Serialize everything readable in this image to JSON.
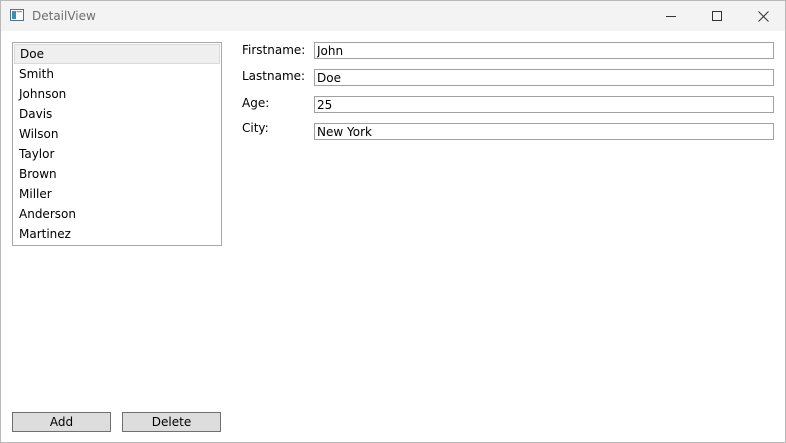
{
  "window": {
    "title": "DetailView",
    "icon": "app-window-icon",
    "controls": [
      "minimize-icon",
      "maximize-icon",
      "close-icon"
    ]
  },
  "list": {
    "items": [
      "Doe",
      "Smith",
      "Johnson",
      "Davis",
      "Wilson",
      "Taylor",
      "Brown",
      "Miller",
      "Anderson",
      "Martinez"
    ],
    "selected": "Doe"
  },
  "form": {
    "firstname_label": "Firstname:",
    "firstname_value": "John",
    "lastname_label": "Lastname:",
    "lastname_value": "Doe",
    "age_label": "Age:",
    "age_value": "25",
    "city_label": "City:",
    "city_value": "New York"
  },
  "buttons": {
    "add_label": "Add",
    "delete_label": "Delete"
  }
}
